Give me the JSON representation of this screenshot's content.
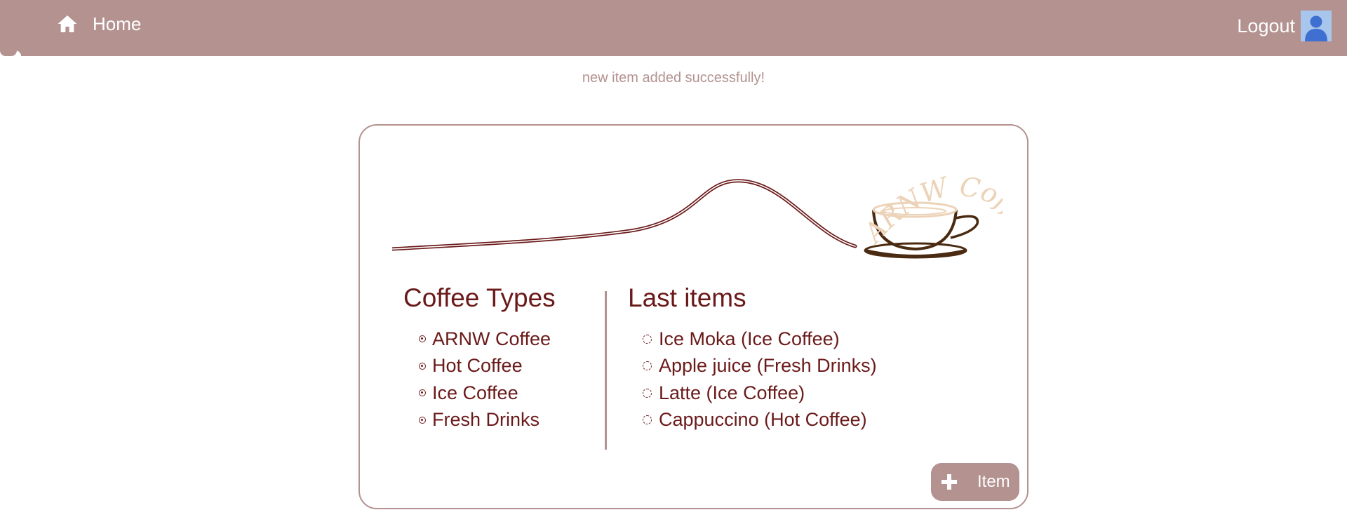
{
  "nav": {
    "home_icon": "home-icon",
    "home_label": "Home",
    "logout_label": "Logout",
    "avatar_icon": "user-avatar-icon"
  },
  "status_message": "new item added successfully!",
  "logo": {
    "text": "ARNW Coffee",
    "icon": "coffee-cup-spoon-logo"
  },
  "coffee_types": {
    "title": "Coffee Types",
    "items": [
      "ARNW Coffee",
      "Hot Coffee",
      "Ice Coffee",
      "Fresh Drinks"
    ]
  },
  "last_items": {
    "title": "Last items",
    "items": [
      "Ice Moka (Ice Coffee)",
      "Apple juice (Fresh Drinks)",
      "Latte (Ice Coffee)",
      "Cappuccino (Hot Coffee)"
    ]
  },
  "add_button": {
    "icon": "plus-icon",
    "label": "Item"
  },
  "colors": {
    "brand": "#b39290",
    "text_dark": "#6b1a1a",
    "logo_text": "#ecd3b8",
    "cup_brown": "#4a2a10"
  }
}
